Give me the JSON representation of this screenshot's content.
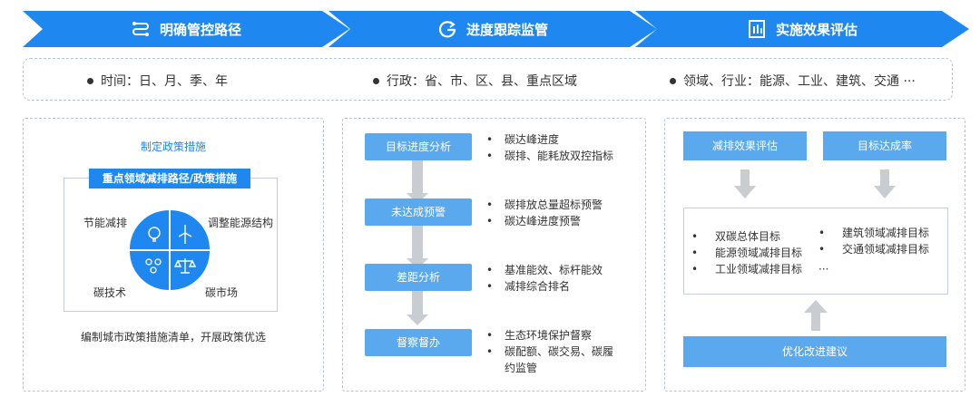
{
  "banner": [
    {
      "label": "明确管控路径",
      "icon": "route-icon"
    },
    {
      "label": "进度跟踪监管",
      "icon": "refresh-g-icon"
    },
    {
      "label": "实施效果评估",
      "icon": "document-chart-icon"
    }
  ],
  "dimensions": [
    "时间：日、月、季、年",
    "行政：省、市、区、县、重点区域",
    "领域、行业：能源、工业、建筑、交通 ···"
  ],
  "panel1": {
    "title": "制定政策措施",
    "banner": "重点领域减排路径/政策措施",
    "quadrants": [
      "节能减排",
      "调整能源结构",
      "碳技术",
      "碳市场"
    ],
    "quadrant_icons": [
      "lightbulb-icon",
      "wind-turbine-icon",
      "molecule-icon",
      "scale-icon"
    ],
    "description": "编制城市政策措施清单，开展政策优选"
  },
  "panel2": {
    "steps": [
      {
        "label": "目标进度分析",
        "bullets": [
          "碳达峰进度",
          "碳排、能耗放双控指标"
        ]
      },
      {
        "label": "未达成预警",
        "bullets": [
          "碳排放总量超标预警",
          "碳达峰进度预警"
        ]
      },
      {
        "label": "差距分析",
        "bullets": [
          "基准能效、标杆能效",
          "减排综合排名"
        ]
      },
      {
        "label": "督察督办",
        "bullets": [
          "生态环境保护督察",
          "碳配额、碳交易、碳履约监管"
        ]
      }
    ]
  },
  "panel3": {
    "boxes": [
      "减排效果评估",
      "目标达成率"
    ],
    "targets_left": [
      "双碳总体目标",
      "能源领域减排目标",
      "工业领域减排目标"
    ],
    "targets_right": [
      "建筑领域减排目标",
      "交通领域减排目标"
    ],
    "targets_more": "···",
    "bottom": "优化改进建议"
  },
  "colors": {
    "primary": "#1e88f0",
    "box": "#5aa9ef",
    "arrow": "#c9ccd0"
  }
}
